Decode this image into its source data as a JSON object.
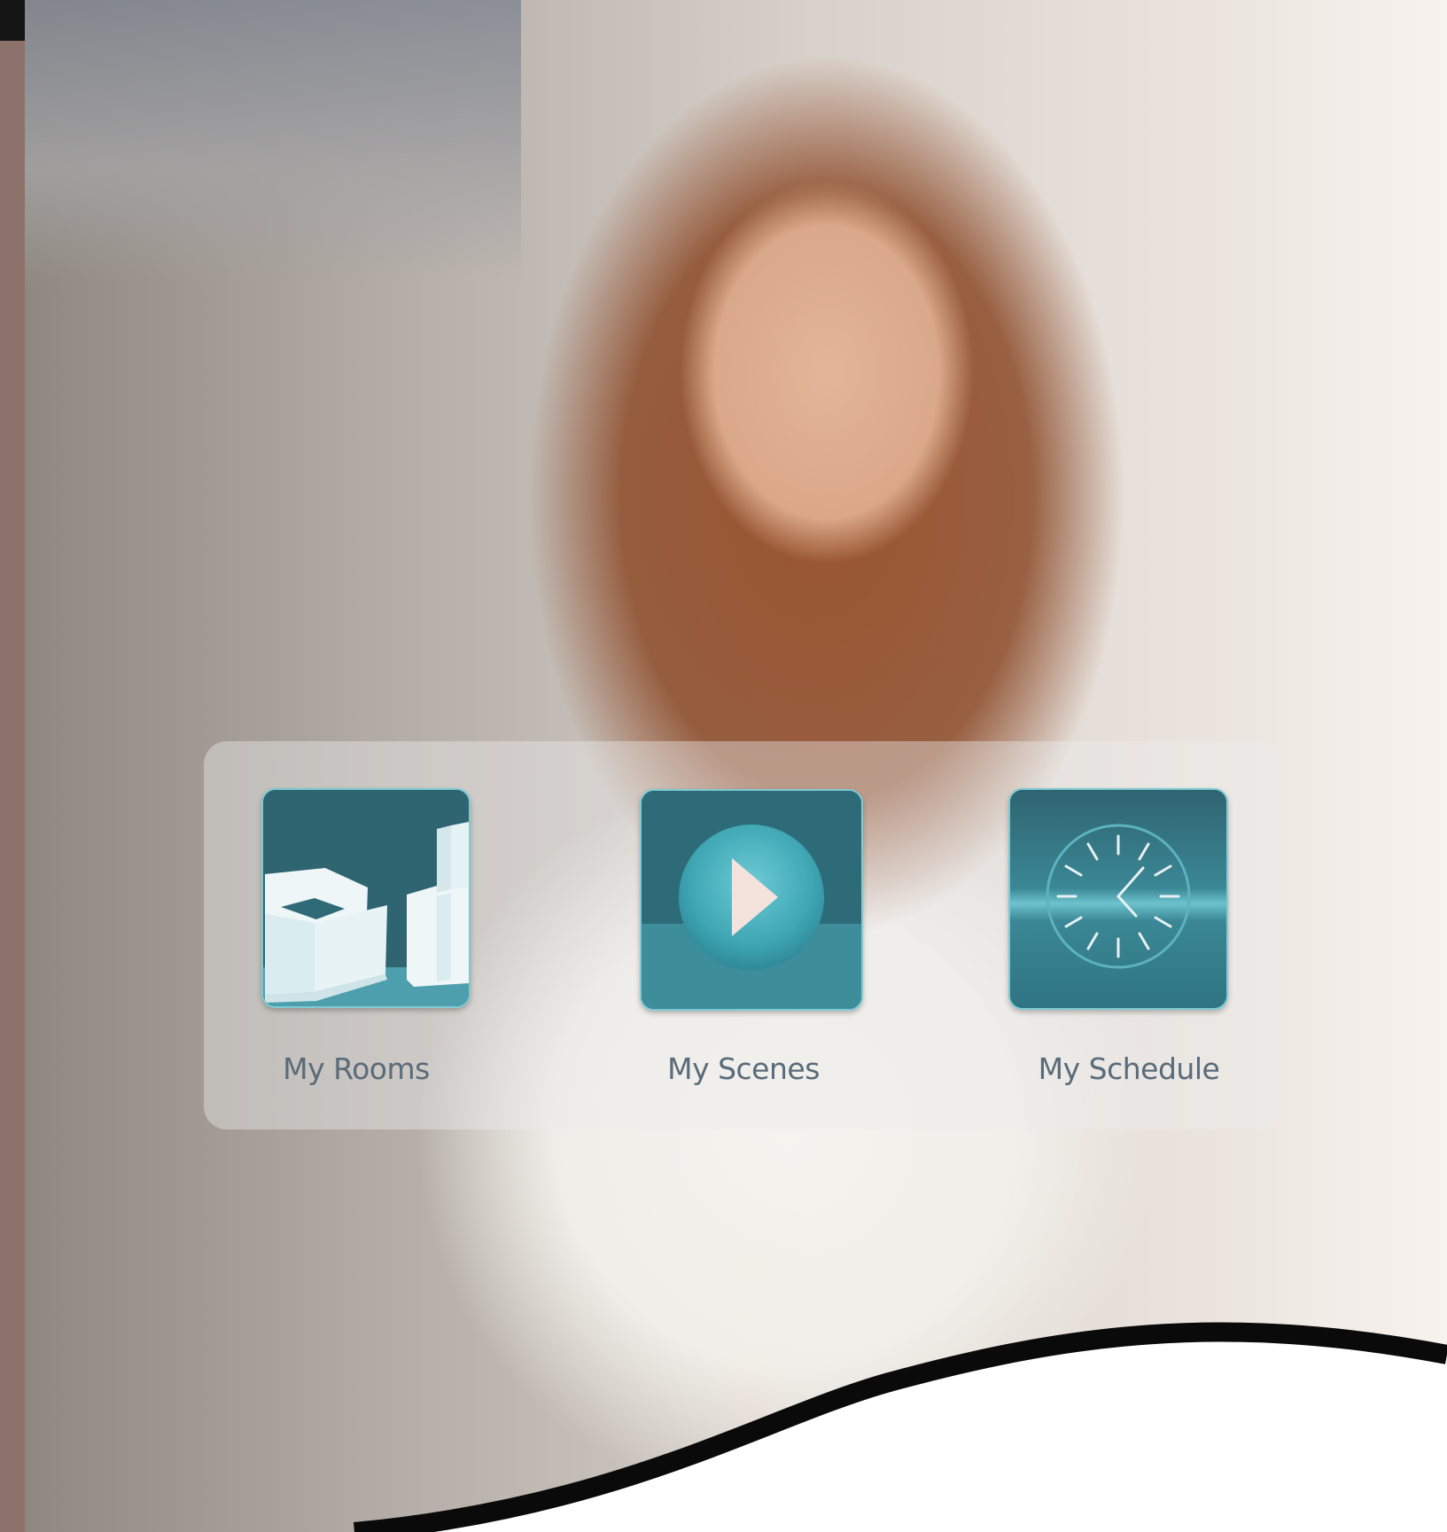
{
  "menu": {
    "items": [
      {
        "id": "rooms",
        "label": "My Rooms",
        "icon": "armchair-icon"
      },
      {
        "id": "scenes",
        "label": "My Scenes",
        "icon": "play-icon"
      },
      {
        "id": "schedule",
        "label": "My Schedule",
        "icon": "clock-icon"
      }
    ]
  },
  "colors": {
    "tile_teal": "#3c8795",
    "tile_highlight": "#56adb9",
    "label_text": "#5a6b79",
    "left_strip": "#8d726b"
  }
}
